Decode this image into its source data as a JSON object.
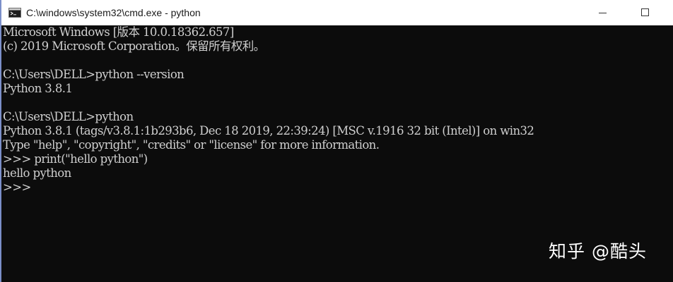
{
  "window": {
    "title": "C:\\windows\\system32\\cmd.exe - python",
    "icon": "cmd-console-icon",
    "controls": {
      "minimize_icon": "minimize-icon",
      "maximize_icon": "maximize-icon"
    }
  },
  "console": {
    "lines": [
      "Microsoft Windows [版本 10.0.18362.657]",
      "(c) 2019 Microsoft Corporation。保留所有权利。",
      "",
      "C:\\Users\\DELL>python --version",
      "Python 3.8.1",
      "",
      "C:\\Users\\DELL>python",
      "Python 3.8.1 (tags/v3.8.1:1b293b6, Dec 18 2019, 22:39:24) [MSC v.1916 32 bit (Intel)] on win32",
      "Type \"help\", \"copyright\", \"credits\" or \"license\" for more information.",
      ">>> print(\"hello python\")",
      "hello python",
      ">>>"
    ]
  },
  "watermark": {
    "text": "知乎 @酷头"
  },
  "colors": {
    "console_bg": "#0c0c0c",
    "console_text": "#cfcfcf",
    "titlebar_bg": "#ffffff"
  }
}
